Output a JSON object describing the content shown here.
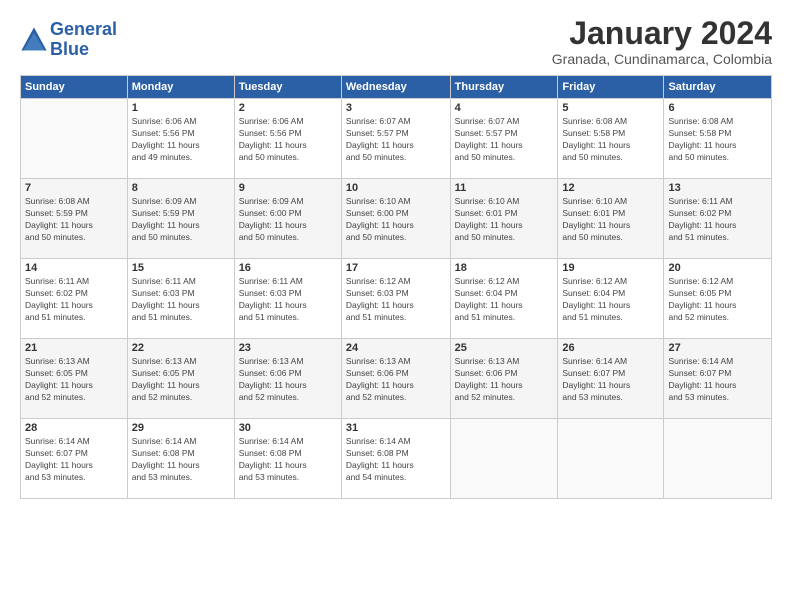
{
  "logo": {
    "name": "General",
    "name2": "Blue"
  },
  "title": "January 2024",
  "subtitle": "Granada, Cundinamarca, Colombia",
  "header_days": [
    "Sunday",
    "Monday",
    "Tuesday",
    "Wednesday",
    "Thursday",
    "Friday",
    "Saturday"
  ],
  "weeks": [
    [
      {
        "day": "",
        "detail": ""
      },
      {
        "day": "1",
        "detail": "Sunrise: 6:06 AM\nSunset: 5:56 PM\nDaylight: 11 hours\nand 49 minutes."
      },
      {
        "day": "2",
        "detail": "Sunrise: 6:06 AM\nSunset: 5:56 PM\nDaylight: 11 hours\nand 50 minutes."
      },
      {
        "day": "3",
        "detail": "Sunrise: 6:07 AM\nSunset: 5:57 PM\nDaylight: 11 hours\nand 50 minutes."
      },
      {
        "day": "4",
        "detail": "Sunrise: 6:07 AM\nSunset: 5:57 PM\nDaylight: 11 hours\nand 50 minutes."
      },
      {
        "day": "5",
        "detail": "Sunrise: 6:08 AM\nSunset: 5:58 PM\nDaylight: 11 hours\nand 50 minutes."
      },
      {
        "day": "6",
        "detail": "Sunrise: 6:08 AM\nSunset: 5:58 PM\nDaylight: 11 hours\nand 50 minutes."
      }
    ],
    [
      {
        "day": "7",
        "detail": "Sunrise: 6:08 AM\nSunset: 5:59 PM\nDaylight: 11 hours\nand 50 minutes."
      },
      {
        "day": "8",
        "detail": "Sunrise: 6:09 AM\nSunset: 5:59 PM\nDaylight: 11 hours\nand 50 minutes."
      },
      {
        "day": "9",
        "detail": "Sunrise: 6:09 AM\nSunset: 6:00 PM\nDaylight: 11 hours\nand 50 minutes."
      },
      {
        "day": "10",
        "detail": "Sunrise: 6:10 AM\nSunset: 6:00 PM\nDaylight: 11 hours\nand 50 minutes."
      },
      {
        "day": "11",
        "detail": "Sunrise: 6:10 AM\nSunset: 6:01 PM\nDaylight: 11 hours\nand 50 minutes."
      },
      {
        "day": "12",
        "detail": "Sunrise: 6:10 AM\nSunset: 6:01 PM\nDaylight: 11 hours\nand 50 minutes."
      },
      {
        "day": "13",
        "detail": "Sunrise: 6:11 AM\nSunset: 6:02 PM\nDaylight: 11 hours\nand 51 minutes."
      }
    ],
    [
      {
        "day": "14",
        "detail": "Sunrise: 6:11 AM\nSunset: 6:02 PM\nDaylight: 11 hours\nand 51 minutes."
      },
      {
        "day": "15",
        "detail": "Sunrise: 6:11 AM\nSunset: 6:03 PM\nDaylight: 11 hours\nand 51 minutes."
      },
      {
        "day": "16",
        "detail": "Sunrise: 6:11 AM\nSunset: 6:03 PM\nDaylight: 11 hours\nand 51 minutes."
      },
      {
        "day": "17",
        "detail": "Sunrise: 6:12 AM\nSunset: 6:03 PM\nDaylight: 11 hours\nand 51 minutes."
      },
      {
        "day": "18",
        "detail": "Sunrise: 6:12 AM\nSunset: 6:04 PM\nDaylight: 11 hours\nand 51 minutes."
      },
      {
        "day": "19",
        "detail": "Sunrise: 6:12 AM\nSunset: 6:04 PM\nDaylight: 11 hours\nand 51 minutes."
      },
      {
        "day": "20",
        "detail": "Sunrise: 6:12 AM\nSunset: 6:05 PM\nDaylight: 11 hours\nand 52 minutes."
      }
    ],
    [
      {
        "day": "21",
        "detail": "Sunrise: 6:13 AM\nSunset: 6:05 PM\nDaylight: 11 hours\nand 52 minutes."
      },
      {
        "day": "22",
        "detail": "Sunrise: 6:13 AM\nSunset: 6:05 PM\nDaylight: 11 hours\nand 52 minutes."
      },
      {
        "day": "23",
        "detail": "Sunrise: 6:13 AM\nSunset: 6:06 PM\nDaylight: 11 hours\nand 52 minutes."
      },
      {
        "day": "24",
        "detail": "Sunrise: 6:13 AM\nSunset: 6:06 PM\nDaylight: 11 hours\nand 52 minutes."
      },
      {
        "day": "25",
        "detail": "Sunrise: 6:13 AM\nSunset: 6:06 PM\nDaylight: 11 hours\nand 52 minutes."
      },
      {
        "day": "26",
        "detail": "Sunrise: 6:14 AM\nSunset: 6:07 PM\nDaylight: 11 hours\nand 53 minutes."
      },
      {
        "day": "27",
        "detail": "Sunrise: 6:14 AM\nSunset: 6:07 PM\nDaylight: 11 hours\nand 53 minutes."
      }
    ],
    [
      {
        "day": "28",
        "detail": "Sunrise: 6:14 AM\nSunset: 6:07 PM\nDaylight: 11 hours\nand 53 minutes."
      },
      {
        "day": "29",
        "detail": "Sunrise: 6:14 AM\nSunset: 6:08 PM\nDaylight: 11 hours\nand 53 minutes."
      },
      {
        "day": "30",
        "detail": "Sunrise: 6:14 AM\nSunset: 6:08 PM\nDaylight: 11 hours\nand 53 minutes."
      },
      {
        "day": "31",
        "detail": "Sunrise: 6:14 AM\nSunset: 6:08 PM\nDaylight: 11 hours\nand 54 minutes."
      },
      {
        "day": "",
        "detail": ""
      },
      {
        "day": "",
        "detail": ""
      },
      {
        "day": "",
        "detail": ""
      }
    ]
  ]
}
